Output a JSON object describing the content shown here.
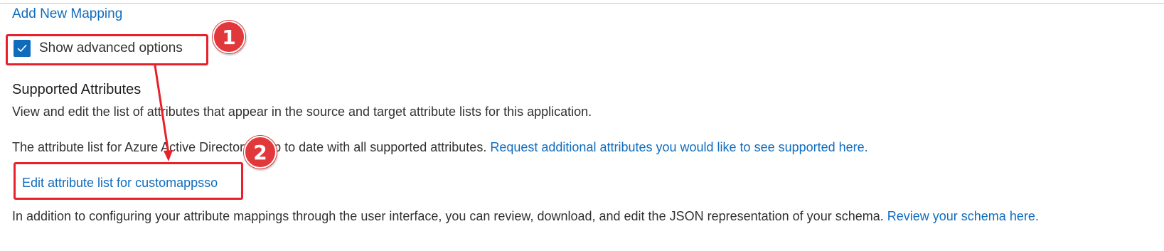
{
  "add_mapping_link": "Add New Mapping",
  "advanced_options": {
    "label": "Show advanced options",
    "checked": true
  },
  "supported_attributes": {
    "title": "Supported Attributes",
    "description": "View and edit the list of attributes that appear in the source and target attribute lists for this application.",
    "aad_note": "The attribute list for Azure Active Directory is up to date with all supported attributes.",
    "request_link": "Request additional attributes you would like to see supported here.",
    "edit_link": "Edit attribute list for customappsso",
    "schema_note": "In addition to configuring your attribute mappings through the user interface, you can review, download, and edit the JSON representation of your schema.",
    "schema_link": "Review your schema here."
  },
  "annotations": {
    "step_1": "1",
    "step_2": "2",
    "accent_color": "#e8202a",
    "link_color": "#0f6cbd",
    "checkbox_color": "#0f6cbd"
  },
  "icons": {
    "checkbox": "checkmark-icon"
  }
}
